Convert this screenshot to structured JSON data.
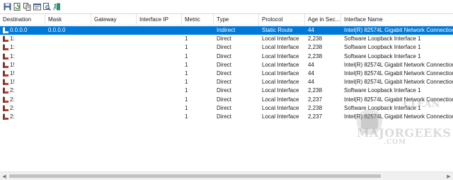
{
  "toolbar": {
    "buttons": [
      "save-icon",
      "refresh-icon",
      "copy-icon",
      "properties-icon",
      "find-icon",
      "exit-icon"
    ]
  },
  "columns": [
    "Destination",
    "Mask",
    "Gateway",
    "Interface IP",
    "Metric",
    "Type",
    "Protocol",
    "Age in Sec...",
    "Interface Name"
  ],
  "rows": [
    {
      "destination": "0.0.0.0",
      "mask": "0.0.0.0",
      "gateway": "",
      "interface_ip": "",
      "metric": "",
      "type": "Indirect",
      "protocol": "Static Route",
      "age": "44",
      "iface": "Intel(R) 82574L Gigabit Network Connection"
    },
    {
      "destination": "1:",
      "mask": "",
      "gateway": "",
      "interface_ip": "",
      "metric": "1",
      "type": "Direct",
      "protocol": "Local Interface",
      "age": "2,238",
      "iface": "Software Loopback Interface 1"
    },
    {
      "destination": "1:",
      "mask": "",
      "gateway": "",
      "interface_ip": "",
      "metric": "1",
      "type": "Direct",
      "protocol": "Local Interface",
      "age": "2,238",
      "iface": "Software Loopback Interface 1"
    },
    {
      "destination": "1:",
      "mask": "",
      "gateway": "",
      "interface_ip": "",
      "metric": "1",
      "type": "Direct",
      "protocol": "Local Interface",
      "age": "2,238",
      "iface": "Software Loopback Interface 1"
    },
    {
      "destination": "1!",
      "mask": "",
      "gateway": "",
      "interface_ip": "",
      "metric": "1",
      "type": "Direct",
      "protocol": "Local Interface",
      "age": "44",
      "iface": "Intel(R) 82574L Gigabit Network Connection"
    },
    {
      "destination": "1!",
      "mask": "",
      "gateway": "",
      "interface_ip": "",
      "metric": "1",
      "type": "Direct",
      "protocol": "Local Interface",
      "age": "44",
      "iface": "Intel(R) 82574L Gigabit Network Connection"
    },
    {
      "destination": "1!",
      "mask": "",
      "gateway": "",
      "interface_ip": "",
      "metric": "1",
      "type": "Direct",
      "protocol": "Local Interface",
      "age": "44",
      "iface": "Intel(R) 82574L Gigabit Network Connection"
    },
    {
      "destination": "2:",
      "mask": "",
      "gateway": "",
      "interface_ip": "",
      "metric": "1",
      "type": "Direct",
      "protocol": "Local Interface",
      "age": "2,238",
      "iface": "Software Loopback Interface 1"
    },
    {
      "destination": "2:",
      "mask": "",
      "gateway": "",
      "interface_ip": "",
      "metric": "1",
      "type": "Direct",
      "protocol": "Local Interface",
      "age": "2,237",
      "iface": "Intel(R) 82574L Gigabit Network Connection"
    },
    {
      "destination": "2:",
      "mask": "",
      "gateway": "",
      "interface_ip": "",
      "metric": "1",
      "type": "Direct",
      "protocol": "Local Interface",
      "age": "2,238",
      "iface": "Software Loopback Interface 1"
    },
    {
      "destination": "2:",
      "mask": "",
      "gateway": "",
      "interface_ip": "",
      "metric": "1",
      "type": "Direct",
      "protocol": "Local Interface",
      "age": "2,237",
      "iface": "Intel(R) 82574L Gigabit Network Connection"
    }
  ],
  "selected_row": 0,
  "watermark": {
    "top": "CLEAN",
    "main": "MAJORGEEKS",
    "com": ".COM"
  },
  "colors": {
    "selection": "#0078d7",
    "header_border": "#e3e3e3"
  }
}
